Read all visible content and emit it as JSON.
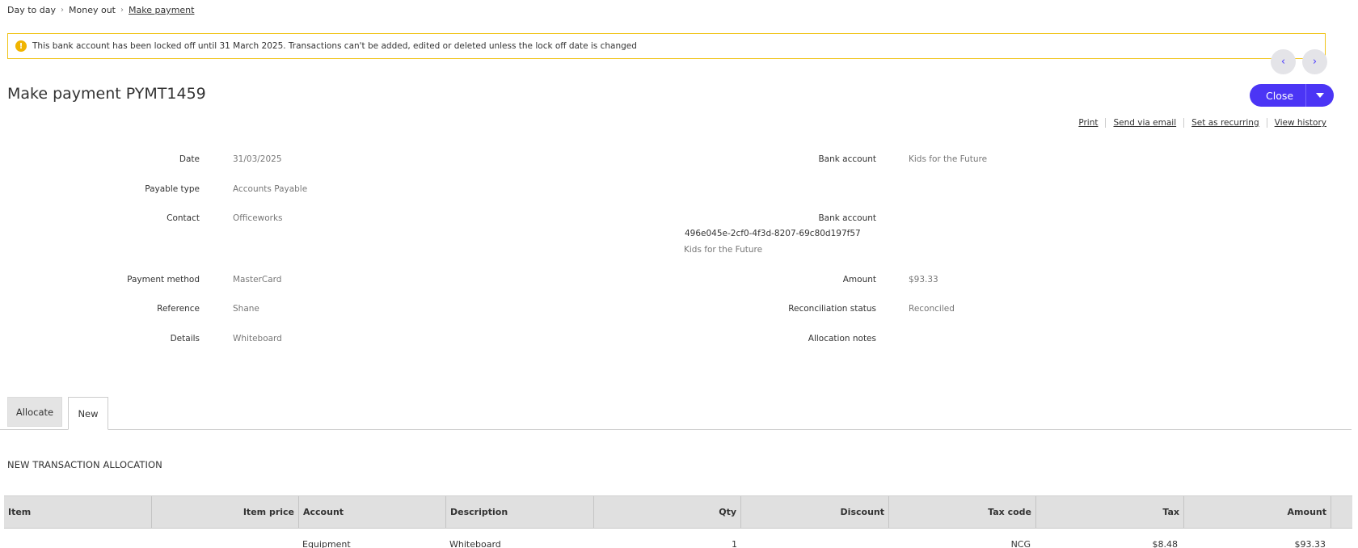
{
  "breadcrumb": {
    "items": [
      "Day to day",
      "Money out",
      "Make payment"
    ]
  },
  "lock_banner": {
    "icon": "warning-icon",
    "message": "This bank account has been locked off until 31 March 2025. Transactions can't be added, edited or deleted unless the lock off date is changed"
  },
  "header": {
    "title": "Make payment PYMT1459",
    "close_label": "Close",
    "actions": [
      "Print",
      "Send via email",
      "Set as recurring",
      "View history"
    ]
  },
  "fields": {
    "date": {
      "label": "Date",
      "value": "31/03/2025"
    },
    "payable_type": {
      "label": "Payable type",
      "value": "Accounts Payable"
    },
    "contact": {
      "label": "Contact",
      "value": "Officeworks"
    },
    "payment_method": {
      "label": "Payment method",
      "value": "MasterCard"
    },
    "reference": {
      "label": "Reference",
      "value": "Shane"
    },
    "details": {
      "label": "Details",
      "value": "Whiteboard"
    },
    "bank_account": {
      "label": "Bank account",
      "value": "Kids for the Future"
    },
    "bank_account_2": {
      "label": "Bank account",
      "id": "496e045e-2cf0-4f3d-8207-69c80d197f57",
      "name": "Kids for the Future"
    },
    "amount": {
      "label": "Amount",
      "value": "$93.33"
    },
    "reconciliation_status": {
      "label": "Reconciliation status",
      "value": "Reconciled"
    },
    "allocation_notes": {
      "label": "Allocation notes",
      "value": ""
    }
  },
  "tabs": [
    "Allocate",
    "New"
  ],
  "allocation": {
    "section_title": "NEW TRANSACTION ALLOCATION",
    "columns": [
      "Item",
      "Item price",
      "Account",
      "Description",
      "Qty",
      "Discount",
      "Tax code",
      "Tax",
      "Amount"
    ],
    "rows": [
      {
        "item": "",
        "item_price": "",
        "account": "Equipment",
        "description": "Whiteboard",
        "qty": "1",
        "discount": "",
        "tax_code": "NCG",
        "tax": "$8.48",
        "amount": "$93.33"
      }
    ]
  },
  "colors": {
    "accent": "#4b35f5",
    "warning_border": "#f0c419",
    "warning_icon": "#f0b400",
    "grid_header": "#e0e0e0"
  }
}
